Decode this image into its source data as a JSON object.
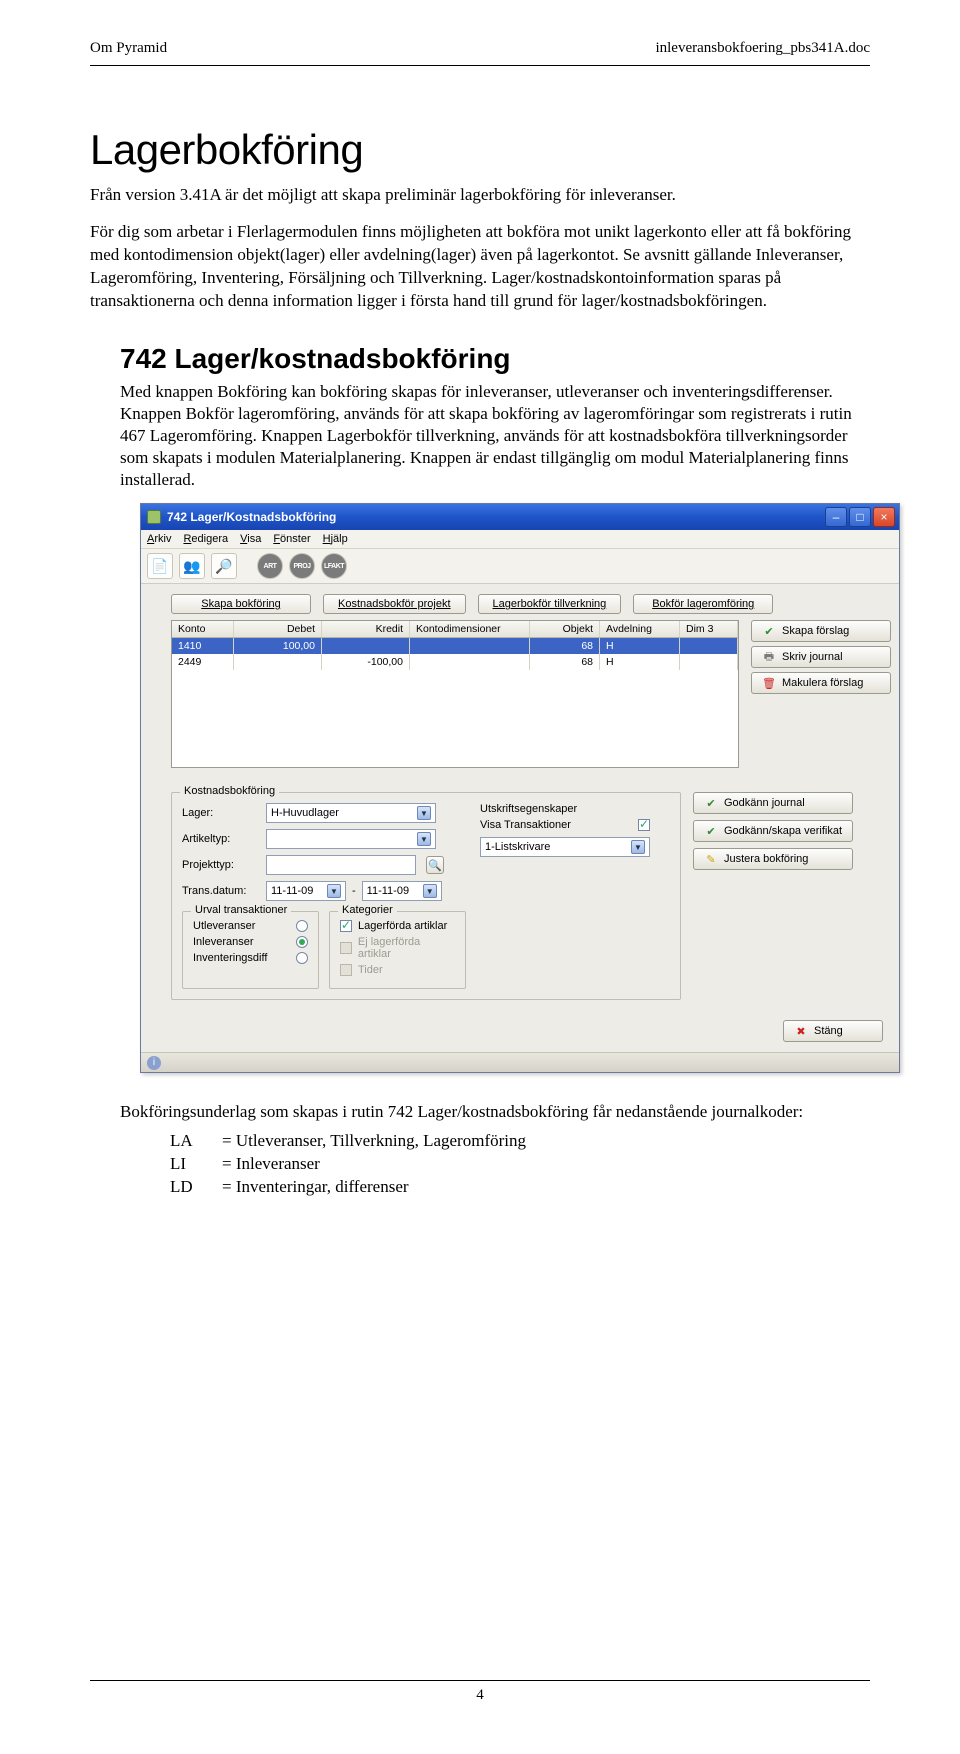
{
  "header": {
    "left": "Om Pyramid",
    "right": "inleveransbokfoering_pbs341A.doc"
  },
  "title": "Lagerbokföring",
  "intro": {
    "p1": "Från version 3.41A är det möjligt att skapa preliminär lagerbokföring för inleveranser.",
    "p2": "För dig som arbetar i Flerlagermodulen finns möjligheten att bokföra mot unikt lagerkonto eller att få bokföring med kontodimension objekt(lager) eller avdelning(lager) även på lagerkontot. Se avsnitt gällande Inleveranser, Lageromföring, Inventering, Försäljning och Tillverkning. Lager/kostnadskontoinformation sparas på transaktionerna och denna information ligger i första hand till grund för lager/kostnadsbokföringen."
  },
  "section": {
    "heading": "742 Lager/kostnadsbokföring",
    "p": "Med knappen Bokföring kan bokföring skapas för inleveranser, utleveranser och inventeringsdifferenser. Knappen Bokför lageromföring, används för att skapa bokföring av lageromföringar som registrerats i rutin 467 Lageromföring. Knappen Lagerbokför tillverkning, används för att kostnadsbokföra tillverkningsorder som skapats i modulen Materialplanering. Knappen är endast tillgänglig om modul Materialplanering finns installerad."
  },
  "win": {
    "title": "742 Lager/Kostnadsbokföring",
    "menu": {
      "arkiv": "Arkiv",
      "redigera": "Redigera",
      "visa": "Visa",
      "fonster": "Fönster",
      "hjalp": "Hjälp"
    },
    "toolbar_round": {
      "a": "ART",
      "b": "PROJ",
      "c": "LFAKT"
    },
    "tabs": {
      "skapa": "Skapa bokföring",
      "kost_projekt": "Kostnadsbokför projekt",
      "lager_tillv": "Lagerbokför tillverkning",
      "bokfor_lager": "Bokför lageromföring"
    },
    "grid": {
      "head": {
        "konto": "Konto",
        "debet": "Debet",
        "kredit": "Kredit",
        "kdim": "Kontodimensioner",
        "objekt": "Objekt",
        "avd": "Avdelning",
        "dim3": "Dim 3"
      },
      "rows": [
        {
          "konto": "1410",
          "debet": "100,00",
          "kredit": "",
          "objekt": "68",
          "avd": "H"
        },
        {
          "konto": "2449",
          "debet": "",
          "kredit": "-100,00",
          "objekt": "68",
          "avd": "H"
        }
      ]
    },
    "side": {
      "skapa": "Skapa förslag",
      "skriv": "Skriv journal",
      "makulera": "Makulera förslag",
      "godkann_j": "Godkänn journal",
      "godkann_v": "Godkänn/skapa verifikat",
      "justera": "Justera bokföring",
      "stang": "Stäng"
    },
    "frame_legend": "Kostnadsbokföring",
    "form": {
      "lager_lbl": "Lager:",
      "lager_val": "H-Huvudlager",
      "artikeltyp_lbl": "Artikeltyp:",
      "projekttyp_lbl": "Projekttyp:",
      "trans_lbl": "Trans.datum:",
      "trans_from": "11-11-09",
      "trans_to": "11-11-09",
      "utskrift_lbl": "Utskriftsegenskaper",
      "visa_trans": "Visa Transaktioner",
      "skrivare": "1-Listskrivare",
      "urval_legend": "Urval transaktioner",
      "urval": {
        "utlev": "Utleveranser",
        "inlev": "Inleveranser",
        "invdiff": "Inventeringsdiff"
      },
      "kat_legend": "Kategorier",
      "kat": {
        "lagerforda": "Lagerförda artiklar",
        "ej": "Ej lagerförda artiklar",
        "tider": "Tider"
      }
    }
  },
  "after": {
    "p": "Bokföringsunderlag som skapas i rutin 742 Lager/kostnadsbokföring får nedanstående journalkoder:",
    "codes": [
      {
        "k": "LA",
        "v": "= Utleveranser, Tillverkning, Lageromföring"
      },
      {
        "k": "LI",
        "v": "= Inleveranser"
      },
      {
        "k": "LD",
        "v": "= Inventeringar, differenser"
      }
    ]
  },
  "page_number": "4"
}
